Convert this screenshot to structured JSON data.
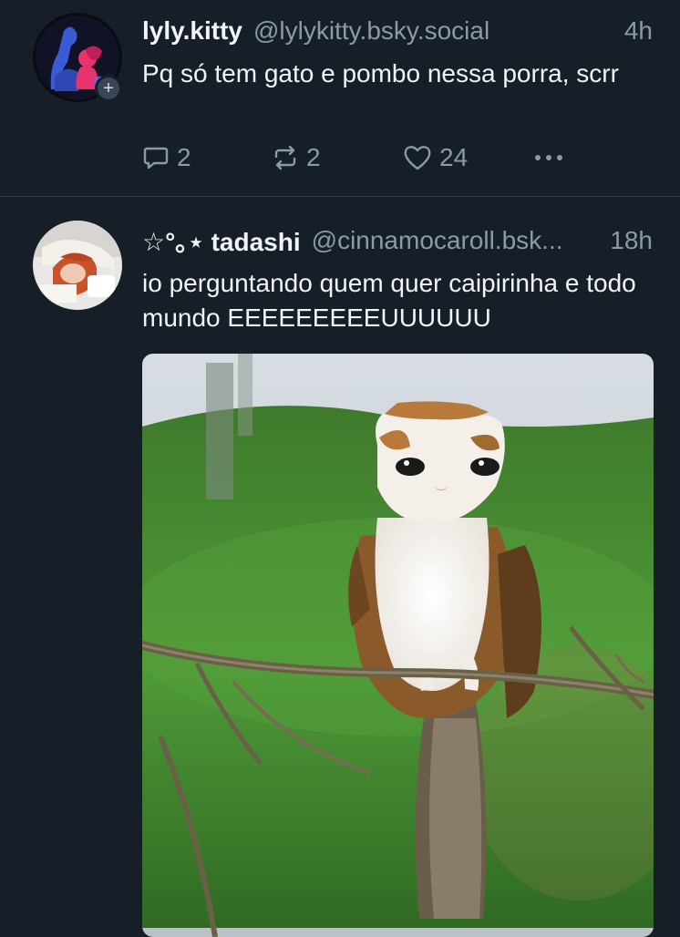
{
  "posts": [
    {
      "display_name": "lyly.kitty",
      "handle": "@lylykitty.bsky.social",
      "time": "4h",
      "text": "Pq só tem gato e pombo nessa porra, scrr",
      "follow_badge": "+",
      "reply_count": "2",
      "repost_count": "2",
      "like_count": "24",
      "avatar_icon": "avatar-illustration",
      "colors": {
        "avatar_accent": "#e8336f",
        "avatar_figure": "#3b5bd6"
      }
    },
    {
      "display_name": "☆°｡⋆ tadashi",
      "handle": "@cinnamocaroll.bsk...",
      "time": "18h",
      "text": "io perguntando quem quer caipirinha e todo mundo EEEEEEEEEUUUUUU",
      "avatar_icon": "avatar-photo",
      "media_icon": "cat-bird-image"
    }
  ],
  "theme": {
    "background": "#161e27",
    "divider": "#2e3a47",
    "text": "#f1f3f5",
    "muted": "#8c99a8"
  }
}
